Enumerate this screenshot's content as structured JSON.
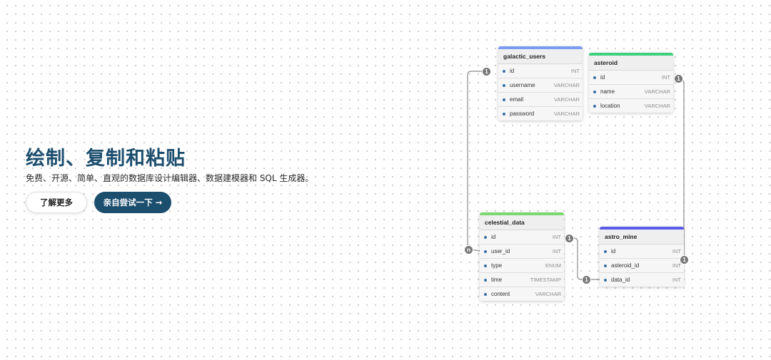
{
  "hero": {
    "title": "绘制、复制和粘贴",
    "subtitle": "免费、开源、简单、直观的数据库设计编辑器、数据建模器和 SQL 生成器。",
    "learn_more_label": "了解更多",
    "try_label": "亲自尝试一下 →"
  },
  "colors": {
    "brand": "#1c4e6e",
    "galactic_users_accent": "#7b9af0",
    "asteroid_accent": "#3fd07e",
    "celestial_data_accent": "#7bd86e",
    "astro_mine_accent": "#5a5ae8",
    "relation_badge": "#777777"
  },
  "relations": {
    "one_label": "1",
    "many_label": "n"
  },
  "tables": {
    "galactic_users": {
      "name": "galactic_users",
      "fields": [
        {
          "name": "id",
          "type": "INT"
        },
        {
          "name": "username",
          "type": "VARCHAR"
        },
        {
          "name": "email",
          "type": "VARCHAR"
        },
        {
          "name": "password",
          "type": "VARCHAR"
        }
      ]
    },
    "asteroid": {
      "name": "asteroid",
      "fields": [
        {
          "name": "id",
          "type": "INT"
        },
        {
          "name": "name",
          "type": "VARCHAR"
        },
        {
          "name": "location",
          "type": "VARCHAR"
        }
      ]
    },
    "celestial_data": {
      "name": "celestial_data",
      "fields": [
        {
          "name": "id",
          "type": "INT"
        },
        {
          "name": "user_id",
          "type": "INT"
        },
        {
          "name": "type",
          "type": "ENUM"
        },
        {
          "name": "time",
          "type": "TIMESTAMP"
        },
        {
          "name": "content",
          "type": "VARCHAR"
        }
      ]
    },
    "astro_mine": {
      "name": "astro_mine",
      "fields": [
        {
          "name": "id",
          "type": "INT"
        },
        {
          "name": "asteroid_id",
          "type": "INT"
        },
        {
          "name": "data_id",
          "type": "INT"
        }
      ]
    }
  }
}
